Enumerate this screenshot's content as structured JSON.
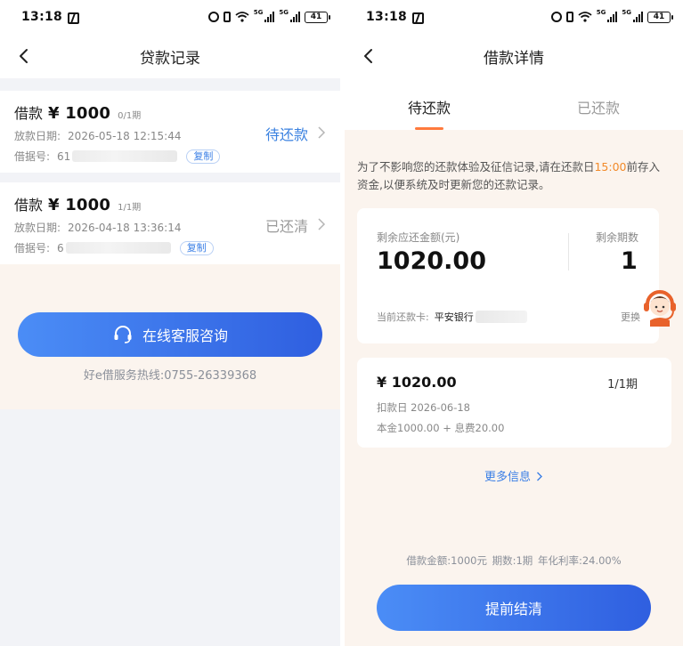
{
  "status_bar": {
    "time": "13:18",
    "battery": "41",
    "net_label_1": "5G",
    "net_label_2": "5G"
  },
  "left_screen": {
    "title": "贷款记录",
    "loans": [
      {
        "label": "借款",
        "amount": "¥ 1000",
        "period": "0/1期",
        "date_label": "放款日期:",
        "date": "2026-05-18 12:15:44",
        "receipt_label": "借据号:",
        "receipt_no_visible": "61",
        "copy_label": "复制",
        "status": "待还款"
      },
      {
        "label": "借款",
        "amount": "¥ 1000",
        "period": "1/1期",
        "date_label": "放款日期:",
        "date": "2026-04-18 13:36:14",
        "receipt_label": "借据号:",
        "receipt_no_visible": "6",
        "copy_label": "复制",
        "status": "已还清"
      }
    ],
    "service_button": "在线客服咨询",
    "hotline": "好e借服务热线:0755-26339368"
  },
  "right_screen": {
    "title": "借款详情",
    "tabs": [
      {
        "label": "待还款",
        "active": true
      },
      {
        "label": "已还款",
        "active": false
      }
    ],
    "notice_before": "为了不影响您的还款体验及征信记录,请在还款日",
    "notice_time": "15:00",
    "notice_after": "前存入资金,以便系统及时更新您的还款记录。",
    "remaining_label": "剩余应还金额(元)",
    "remaining_amount": "1020.00",
    "periods_label": "剩余期数",
    "periods_value": "1",
    "card_label": "当前还款卡:",
    "card_bank": "平安银行",
    "change_label": "更换",
    "installment": {
      "amount": "¥ 1020.00",
      "period": "1/1期",
      "deduct_date": "扣款日 2026-06-18",
      "breakdown": "本金1000.00 + 息费20.00"
    },
    "more_info": "更多信息",
    "loan_summary": "借款金额:1000元 期数:1期 年化利率:24.00%",
    "prepay_button": "提前结清"
  },
  "colors": {
    "accent_blue": "#3b7fe6",
    "button_gradient_start": "#4b8df6",
    "button_gradient_end": "#2f5fe0",
    "highlight_orange": "#f28a2a",
    "tab_indicator": "#ff7a3d",
    "cream_bg": "#fbf4ee"
  },
  "icons": {
    "back": "chevron-left-icon",
    "row_arrow": "chevron-right-icon",
    "headset": "headset-icon",
    "customer_service": "customer-service-avatar-icon"
  }
}
